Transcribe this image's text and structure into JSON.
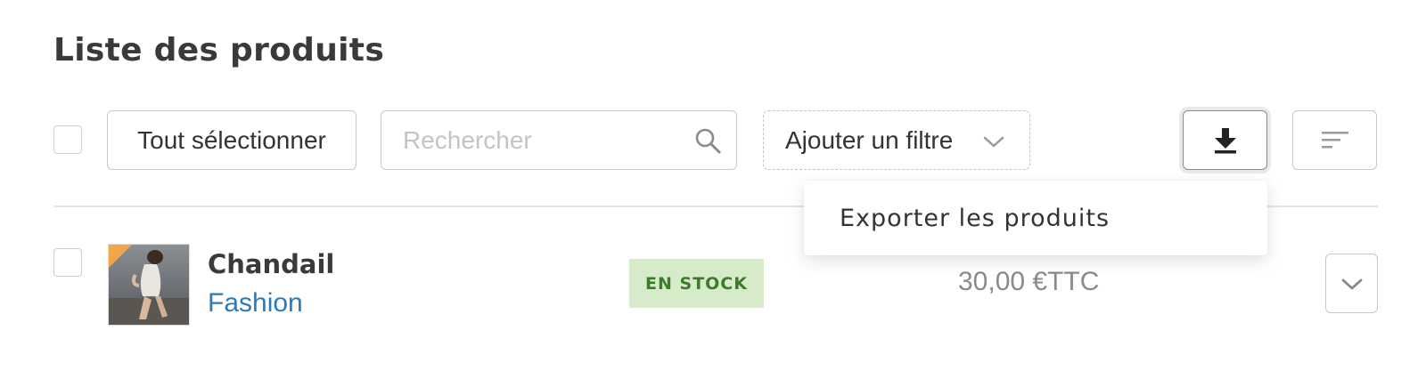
{
  "page": {
    "title": "Liste des produits"
  },
  "toolbar": {
    "select_all_label": "Tout sélectionner",
    "search_placeholder": "Rechercher",
    "search_value": "",
    "filter_label": "Ajouter un filtre",
    "export_icon": "download-icon",
    "sort_icon": "sort-icon"
  },
  "export_menu": {
    "items": [
      {
        "label": "Exporter les produits"
      }
    ]
  },
  "products": [
    {
      "name": "Chandail",
      "category": "Fashion",
      "status": "EN STOCK",
      "price": "30,00 €TTC",
      "status_color": "#d6ebc9",
      "category_color": "#2c7ab8"
    }
  ]
}
